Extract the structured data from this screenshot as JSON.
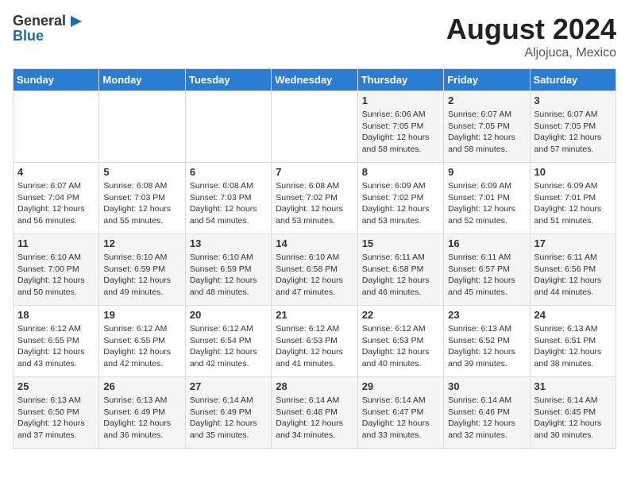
{
  "header": {
    "logo_general": "General",
    "logo_blue": "Blue",
    "main_title": "August 2024",
    "subtitle": "Aljojuca, Mexico"
  },
  "days_of_week": [
    "Sunday",
    "Monday",
    "Tuesday",
    "Wednesday",
    "Thursday",
    "Friday",
    "Saturday"
  ],
  "weeks": [
    [
      {
        "day": "",
        "info": ""
      },
      {
        "day": "",
        "info": ""
      },
      {
        "day": "",
        "info": ""
      },
      {
        "day": "",
        "info": ""
      },
      {
        "day": "1",
        "info": "Sunrise: 6:06 AM\nSunset: 7:05 PM\nDaylight: 12 hours\nand 58 minutes."
      },
      {
        "day": "2",
        "info": "Sunrise: 6:07 AM\nSunset: 7:05 PM\nDaylight: 12 hours\nand 58 minutes."
      },
      {
        "day": "3",
        "info": "Sunrise: 6:07 AM\nSunset: 7:05 PM\nDaylight: 12 hours\nand 57 minutes."
      }
    ],
    [
      {
        "day": "4",
        "info": "Sunrise: 6:07 AM\nSunset: 7:04 PM\nDaylight: 12 hours\nand 56 minutes."
      },
      {
        "day": "5",
        "info": "Sunrise: 6:08 AM\nSunset: 7:03 PM\nDaylight: 12 hours\nand 55 minutes."
      },
      {
        "day": "6",
        "info": "Sunrise: 6:08 AM\nSunset: 7:03 PM\nDaylight: 12 hours\nand 54 minutes."
      },
      {
        "day": "7",
        "info": "Sunrise: 6:08 AM\nSunset: 7:02 PM\nDaylight: 12 hours\nand 53 minutes."
      },
      {
        "day": "8",
        "info": "Sunrise: 6:09 AM\nSunset: 7:02 PM\nDaylight: 12 hours\nand 53 minutes."
      },
      {
        "day": "9",
        "info": "Sunrise: 6:09 AM\nSunset: 7:01 PM\nDaylight: 12 hours\nand 52 minutes."
      },
      {
        "day": "10",
        "info": "Sunrise: 6:09 AM\nSunset: 7:01 PM\nDaylight: 12 hours\nand 51 minutes."
      }
    ],
    [
      {
        "day": "11",
        "info": "Sunrise: 6:10 AM\nSunset: 7:00 PM\nDaylight: 12 hours\nand 50 minutes."
      },
      {
        "day": "12",
        "info": "Sunrise: 6:10 AM\nSunset: 6:59 PM\nDaylight: 12 hours\nand 49 minutes."
      },
      {
        "day": "13",
        "info": "Sunrise: 6:10 AM\nSunset: 6:59 PM\nDaylight: 12 hours\nand 48 minutes."
      },
      {
        "day": "14",
        "info": "Sunrise: 6:10 AM\nSunset: 6:58 PM\nDaylight: 12 hours\nand 47 minutes."
      },
      {
        "day": "15",
        "info": "Sunrise: 6:11 AM\nSunset: 6:58 PM\nDaylight: 12 hours\nand 46 minutes."
      },
      {
        "day": "16",
        "info": "Sunrise: 6:11 AM\nSunset: 6:57 PM\nDaylight: 12 hours\nand 45 minutes."
      },
      {
        "day": "17",
        "info": "Sunrise: 6:11 AM\nSunset: 6:56 PM\nDaylight: 12 hours\nand 44 minutes."
      }
    ],
    [
      {
        "day": "18",
        "info": "Sunrise: 6:12 AM\nSunset: 6:55 PM\nDaylight: 12 hours\nand 43 minutes."
      },
      {
        "day": "19",
        "info": "Sunrise: 6:12 AM\nSunset: 6:55 PM\nDaylight: 12 hours\nand 42 minutes."
      },
      {
        "day": "20",
        "info": "Sunrise: 6:12 AM\nSunset: 6:54 PM\nDaylight: 12 hours\nand 42 minutes."
      },
      {
        "day": "21",
        "info": "Sunrise: 6:12 AM\nSunset: 6:53 PM\nDaylight: 12 hours\nand 41 minutes."
      },
      {
        "day": "22",
        "info": "Sunrise: 6:12 AM\nSunset: 6:53 PM\nDaylight: 12 hours\nand 40 minutes."
      },
      {
        "day": "23",
        "info": "Sunrise: 6:13 AM\nSunset: 6:52 PM\nDaylight: 12 hours\nand 39 minutes."
      },
      {
        "day": "24",
        "info": "Sunrise: 6:13 AM\nSunset: 6:51 PM\nDaylight: 12 hours\nand 38 minutes."
      }
    ],
    [
      {
        "day": "25",
        "info": "Sunrise: 6:13 AM\nSunset: 6:50 PM\nDaylight: 12 hours\nand 37 minutes."
      },
      {
        "day": "26",
        "info": "Sunrise: 6:13 AM\nSunset: 6:49 PM\nDaylight: 12 hours\nand 36 minutes."
      },
      {
        "day": "27",
        "info": "Sunrise: 6:14 AM\nSunset: 6:49 PM\nDaylight: 12 hours\nand 35 minutes."
      },
      {
        "day": "28",
        "info": "Sunrise: 6:14 AM\nSunset: 6:48 PM\nDaylight: 12 hours\nand 34 minutes."
      },
      {
        "day": "29",
        "info": "Sunrise: 6:14 AM\nSunset: 6:47 PM\nDaylight: 12 hours\nand 33 minutes."
      },
      {
        "day": "30",
        "info": "Sunrise: 6:14 AM\nSunset: 6:46 PM\nDaylight: 12 hours\nand 32 minutes."
      },
      {
        "day": "31",
        "info": "Sunrise: 6:14 AM\nSunset: 6:45 PM\nDaylight: 12 hours\nand 30 minutes."
      }
    ]
  ]
}
